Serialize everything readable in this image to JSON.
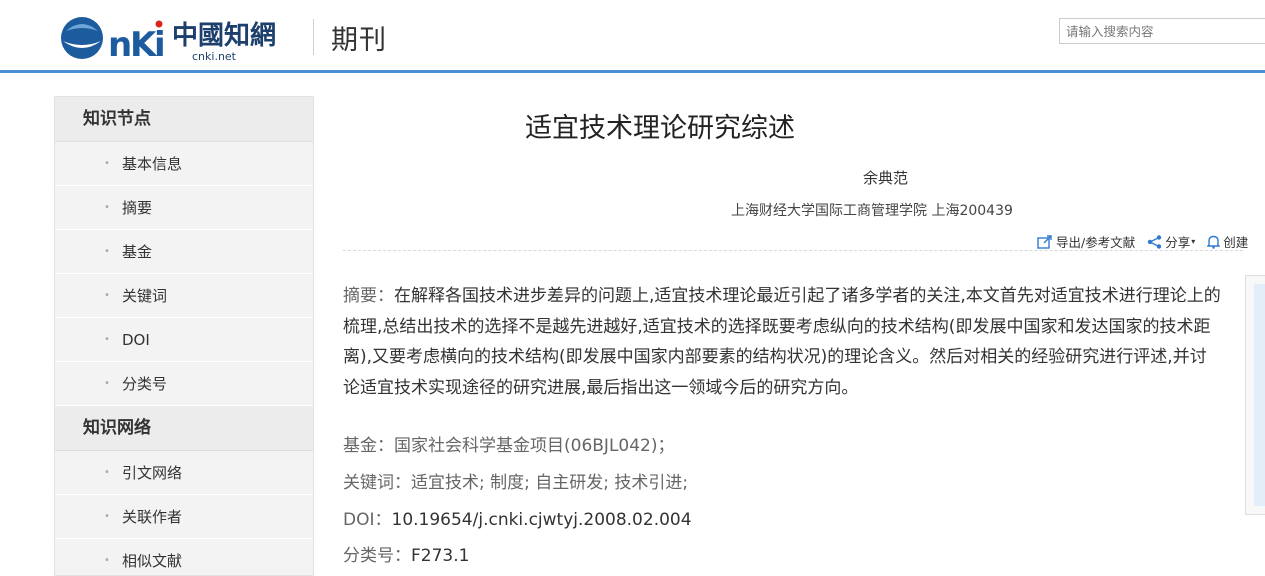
{
  "header": {
    "logo_text": "CNKI中国知网",
    "logo_subtitle": "cnki.net",
    "section_title": "期刊",
    "search_placeholder": "请输入搜索内容"
  },
  "sidebar": {
    "groups": [
      {
        "title": "知识节点",
        "items": [
          "基本信息",
          "摘要",
          "基金",
          "关键词",
          "DOI",
          "分类号"
        ]
      },
      {
        "title": "知识网络",
        "items": [
          "引文网络",
          "关联作者",
          "相似文献"
        ]
      }
    ]
  },
  "article": {
    "title": "适宜技术理论研究综述",
    "author": "余典范",
    "organization": "上海财经大学国际工商管理学院 上海200439",
    "tools": {
      "export": "导出/参考文献",
      "share": "分享",
      "create": "创建"
    },
    "abstract_label": "摘要：",
    "abstract_text": "在解释各国技术进步差异的问题上,适宜技术理论最近引起了诸多学者的关注,本文首先对适宜技术进行理论上的梳理,总结出技术的选择不是越先进越好,适宜技术的选择既要考虑纵向的技术结构(即发展中国家和发达国家的技术距离),又要考虑横向的技术结构(即发展中国家内部要素的结构状况)的理论含义。然后对相关的经验研究进行评述,并讨论适宜技术实现途径的研究进展,最后指出这一领域今后的研究方向。",
    "fund_label": "基金：",
    "fund_value": "国家社会科学基金项目(06BJL042)；",
    "keywords_label": "关键词：",
    "keywords_value": "适宜技术; 制度; 自主研发; 技术引进;",
    "doi_label": "DOI：",
    "doi_value": "10.19654/j.cnki.cjwtyj.2008.02.004",
    "class_label": "分类号：",
    "class_value": "F273.1"
  },
  "colors": {
    "accent": "#4a8fd1",
    "logo_blue": "#1c5b9e",
    "logo_red": "#d9251d"
  }
}
